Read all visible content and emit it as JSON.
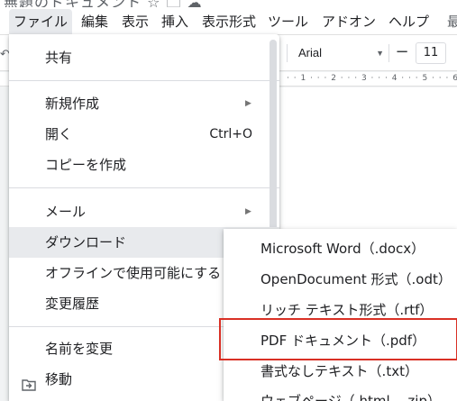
{
  "title_bar": {
    "doc_title_fragment": "無題のドキュメント ☆ 🗀 ☁"
  },
  "menubar": {
    "items": [
      {
        "label": "ファイル"
      },
      {
        "label": "編集"
      },
      {
        "label": "表示"
      },
      {
        "label": "挿入"
      },
      {
        "label": "表示形式"
      },
      {
        "label": "ツール"
      },
      {
        "label": "アドオン"
      },
      {
        "label": "ヘルプ"
      },
      {
        "label": "最"
      }
    ]
  },
  "toolbar": {
    "font_family": "Arial",
    "font_size": "11",
    "decrease_label": "−"
  },
  "ruler": {
    "marks": "· · 1 · · · 2 · · · 3 · · · 4 · · · 5 · · · 6 ·"
  },
  "file_menu": {
    "items": [
      {
        "label": "共有"
      },
      {
        "label": "新規作成",
        "has_submenu": true
      },
      {
        "label": "開く",
        "shortcut": "Ctrl+O"
      },
      {
        "label": "コピーを作成"
      },
      {
        "label": "メール",
        "has_submenu": true
      },
      {
        "label": "ダウンロード",
        "has_submenu": true,
        "highlighted": true
      },
      {
        "label": "オフラインで使用可能にする"
      },
      {
        "label": "変更履歴",
        "has_submenu": true
      },
      {
        "label": "名前を変更"
      },
      {
        "label": "移動",
        "icon": "move-folder-icon"
      }
    ]
  },
  "download_submenu": {
    "items": [
      {
        "label": "Microsoft Word（.docx）"
      },
      {
        "label": "OpenDocument 形式（.odt）"
      },
      {
        "label": "リッチ テキスト形式（.rtf）"
      },
      {
        "label": "PDF ドキュメント（.pdf）",
        "emphasized": true
      },
      {
        "label": "書式なしテキスト（.txt）"
      },
      {
        "label": "ウェブページ（.html、.zip）"
      }
    ]
  },
  "colors": {
    "menu_active_bg": "#e8eaed",
    "emphasis_border": "#d93025"
  }
}
